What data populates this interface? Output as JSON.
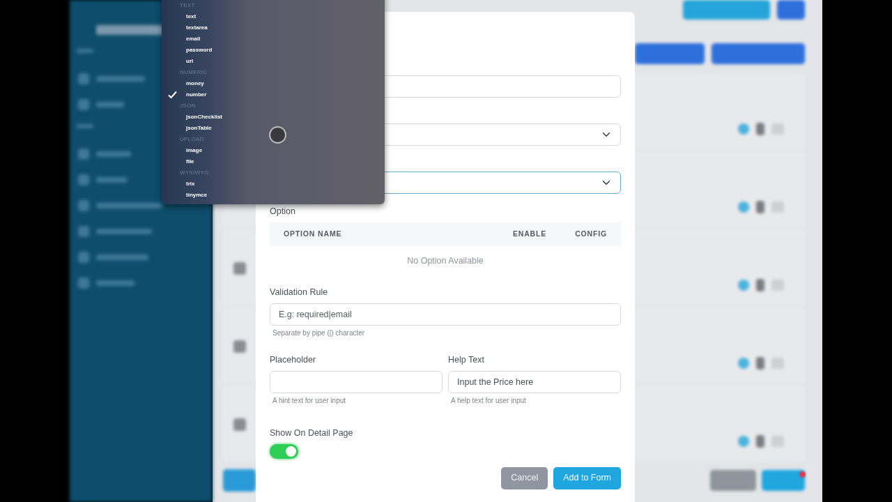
{
  "type_menu": {
    "groups": [
      {
        "label": "TEXT",
        "items": [
          {
            "label": "text",
            "selected": false
          },
          {
            "label": "textarea",
            "selected": false
          },
          {
            "label": "email",
            "selected": false
          },
          {
            "label": "password",
            "selected": false
          },
          {
            "label": "url",
            "selected": false
          }
        ]
      },
      {
        "label": "NUMERIC",
        "items": [
          {
            "label": "money",
            "selected": false
          },
          {
            "label": "number",
            "selected": true
          }
        ]
      },
      {
        "label": "JSON",
        "items": [
          {
            "label": "jsonChecklist",
            "selected": false
          },
          {
            "label": "jsonTable",
            "selected": false
          }
        ]
      },
      {
        "label": "UPLOAD",
        "items": [
          {
            "label": "image",
            "selected": false
          },
          {
            "label": "file",
            "selected": false
          }
        ]
      },
      {
        "label": "WYSIWYG",
        "items": [
          {
            "label": "trix",
            "selected": false
          },
          {
            "label": "tinymce",
            "selected": false
          }
        ]
      }
    ]
  },
  "modal": {
    "top_fields": [
      {
        "kind": "input",
        "focused": false
      },
      {
        "kind": "select",
        "focused": false
      },
      {
        "kind": "select",
        "focused": true
      }
    ],
    "option": {
      "label": "Option",
      "columns": [
        "OPTION NAME",
        "ENABLE",
        "CONFIG"
      ],
      "empty_text": "No Option Available"
    },
    "validation": {
      "label": "Validation Rule",
      "placeholder": "E.g: required|email",
      "hint": "Separate by pipe (|) character"
    },
    "placeholder_field": {
      "label": "Placeholder",
      "hint": "A hint text for user input"
    },
    "help_field": {
      "label": "Help Text",
      "value": "Input the Price here",
      "hint": "A help text for user input"
    },
    "show_on_detail": {
      "label": "Show On Detail Page",
      "on": true
    },
    "buttons": [
      {
        "label": "Cancel",
        "kind": "secondary"
      },
      {
        "label": "Add to Form",
        "kind": "primary"
      }
    ]
  }
}
